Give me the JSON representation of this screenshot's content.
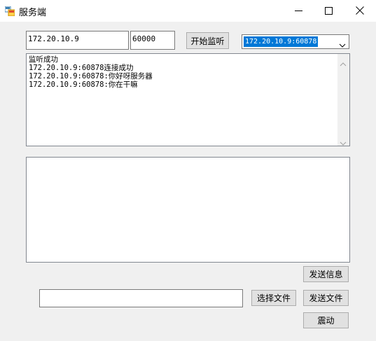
{
  "window": {
    "title": "服务端",
    "icon": "winforms-app-icon",
    "controls": [
      "minimize-icon",
      "maximize-icon",
      "close-icon"
    ]
  },
  "connection": {
    "ip_value": "172.20.10.9",
    "port_value": "60000",
    "listen_label": "开始监听",
    "selected_client": "172.20.10.9:60878"
  },
  "log": {
    "lines": [
      "监听成功",
      "172.20.10.9:60878连接成功",
      "172.20.10.9:60878:你好呀服务器",
      "172.20.10.9:60878:你在干嘛"
    ]
  },
  "message": {
    "value": ""
  },
  "actions": {
    "send_message_label": "发送信息",
    "choose_file_label": "选择文件",
    "send_file_label": "发送文件",
    "shake_label": "震动"
  },
  "file": {
    "path_value": ""
  },
  "colors": {
    "window_bg": "#f0f0f0",
    "selection": "#0078d7",
    "button_bg": "#e1e1e1"
  }
}
